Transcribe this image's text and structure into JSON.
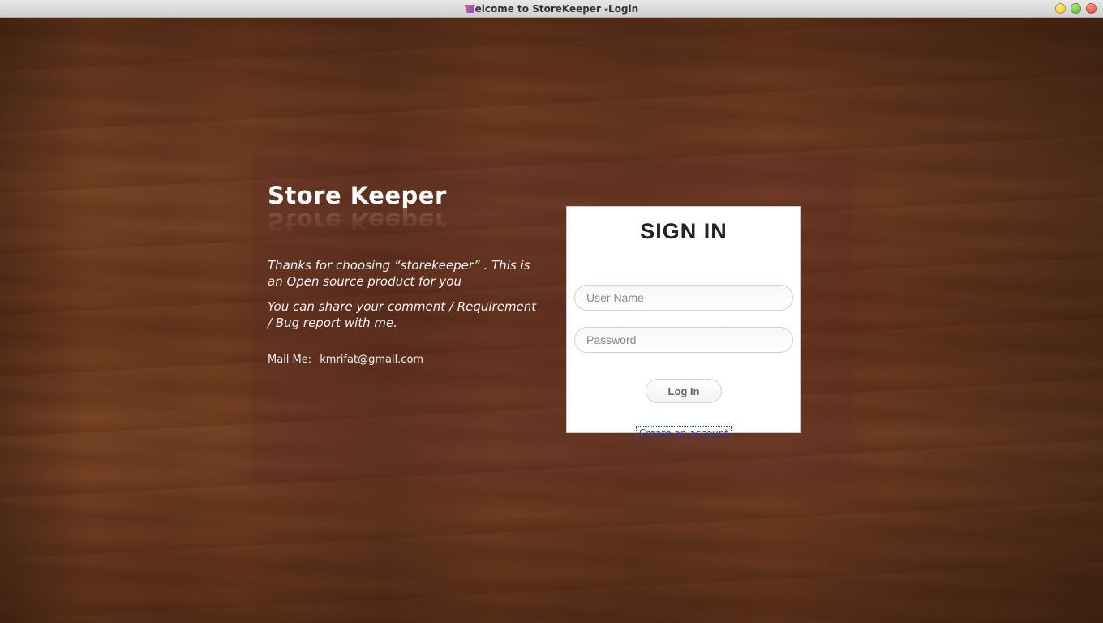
{
  "window": {
    "title": "Welcome to StoreKeeper -Login"
  },
  "left": {
    "app_title": "Store Keeper",
    "intro1": "Thanks for choosing “storekeeper” . This is an Open source product for you",
    "intro2": "You can share your comment / Requirement / Bug report with me.",
    "mail_label": "Mail Me:",
    "mail_value": "kmrifat@gmail.com"
  },
  "login": {
    "heading": "SIGN IN",
    "username_placeholder": "User Name",
    "password_placeholder": "Password",
    "button_label": "Log In",
    "create_link": "Create an account"
  }
}
